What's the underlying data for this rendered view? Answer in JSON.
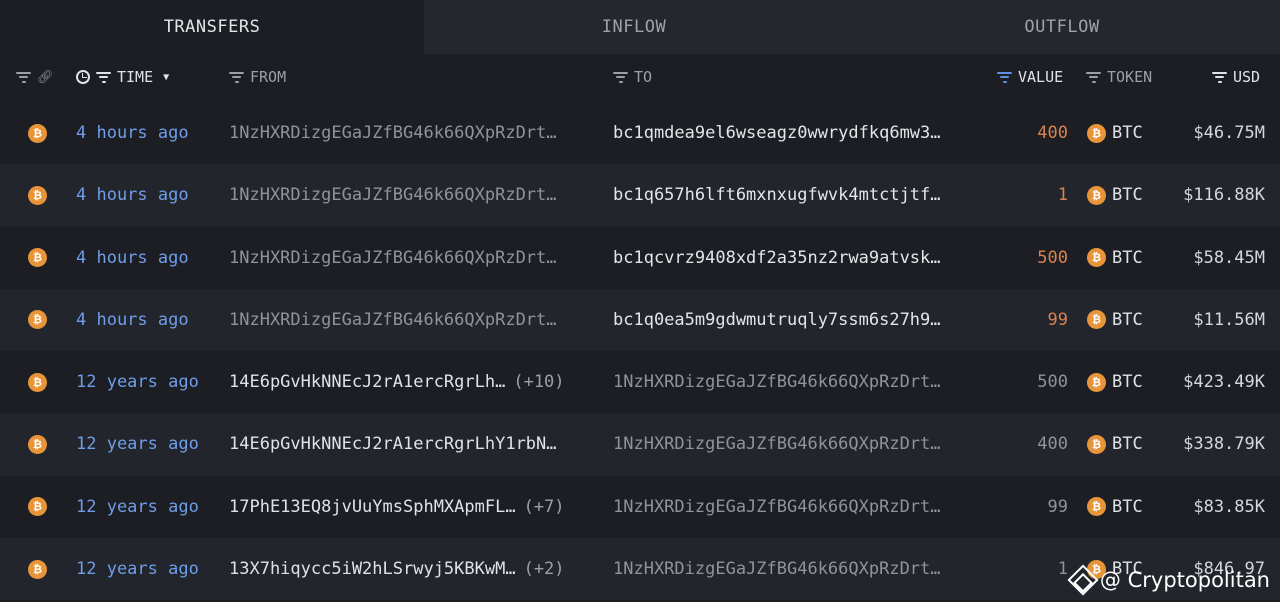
{
  "tabs": [
    {
      "label": "TRANSFERS",
      "active": true
    },
    {
      "label": "INFLOW",
      "active": false
    },
    {
      "label": "OUTFLOW",
      "active": false
    }
  ],
  "columns": {
    "time": "TIME",
    "from": "FROM",
    "to": "TO",
    "value": "VALUE",
    "token": "TOKEN",
    "usd": "USD"
  },
  "rows": [
    {
      "time": "4 hours ago",
      "from": "1NzHXRDizgEGaJZfBG46k66QXpRzDrt…",
      "from_extra": "",
      "to": "bc1qmdea9el6wseagz0wwrydfkq6mw3…",
      "value": "400",
      "token": "BTC",
      "usd": "$46.75M"
    },
    {
      "time": "4 hours ago",
      "from": "1NzHXRDizgEGaJZfBG46k66QXpRzDrt…",
      "from_extra": "",
      "to": "bc1q657h6lft6mxnxugfwvk4mtctjtf…",
      "value": "1",
      "token": "BTC",
      "usd": "$116.88K"
    },
    {
      "time": "4 hours ago",
      "from": "1NzHXRDizgEGaJZfBG46k66QXpRzDrt…",
      "from_extra": "",
      "to": "bc1qcvrz9408xdf2a35nz2rwa9atvsk…",
      "value": "500",
      "token": "BTC",
      "usd": "$58.45M"
    },
    {
      "time": "4 hours ago",
      "from": "1NzHXRDizgEGaJZfBG46k66QXpRzDrt…",
      "from_extra": "",
      "to": "bc1q0ea5m9gdwmutruqly7ssm6s27h9…",
      "value": "99",
      "token": "BTC",
      "usd": "$11.56M"
    },
    {
      "time": "12 years ago",
      "from": "14E6pGvHkNNEcJ2rA1ercRgrLh…",
      "from_extra": "(+10)",
      "to": "1NzHXRDizgEGaJZfBG46k66QXpRzDrt…",
      "value": "500",
      "token": "BTC",
      "usd": "$423.49K"
    },
    {
      "time": "12 years ago",
      "from": "14E6pGvHkNNEcJ2rA1ercRgrLhY1rbN…",
      "from_extra": "",
      "to": "1NzHXRDizgEGaJZfBG46k66QXpRzDrt…",
      "value": "400",
      "token": "BTC",
      "usd": "$338.79K"
    },
    {
      "time": "12 years ago",
      "from": "17PhE13EQ8jvUuYmsSphMXApmFL…",
      "from_extra": "(+7)",
      "to": "1NzHXRDizgEGaJZfBG46k66QXpRzDrt…",
      "value": "99",
      "token": "BTC",
      "usd": "$83.85K"
    },
    {
      "time": "12 years ago",
      "from": "13X7hiqycc5iW2hLSrwyj5KBKwM…",
      "from_extra": "(+2)",
      "to": "1NzHXRDizgEGaJZfBG46k66QXpRzDrt…",
      "value": "1",
      "token": "BTC",
      "usd": "$846.97"
    }
  ],
  "coin_glyph": "₿",
  "watermark": "@ Cryptopolitan",
  "colors": {
    "accent_blue": "#6f9de8",
    "value_orange": "#d98350",
    "btc": "#e8953a"
  }
}
